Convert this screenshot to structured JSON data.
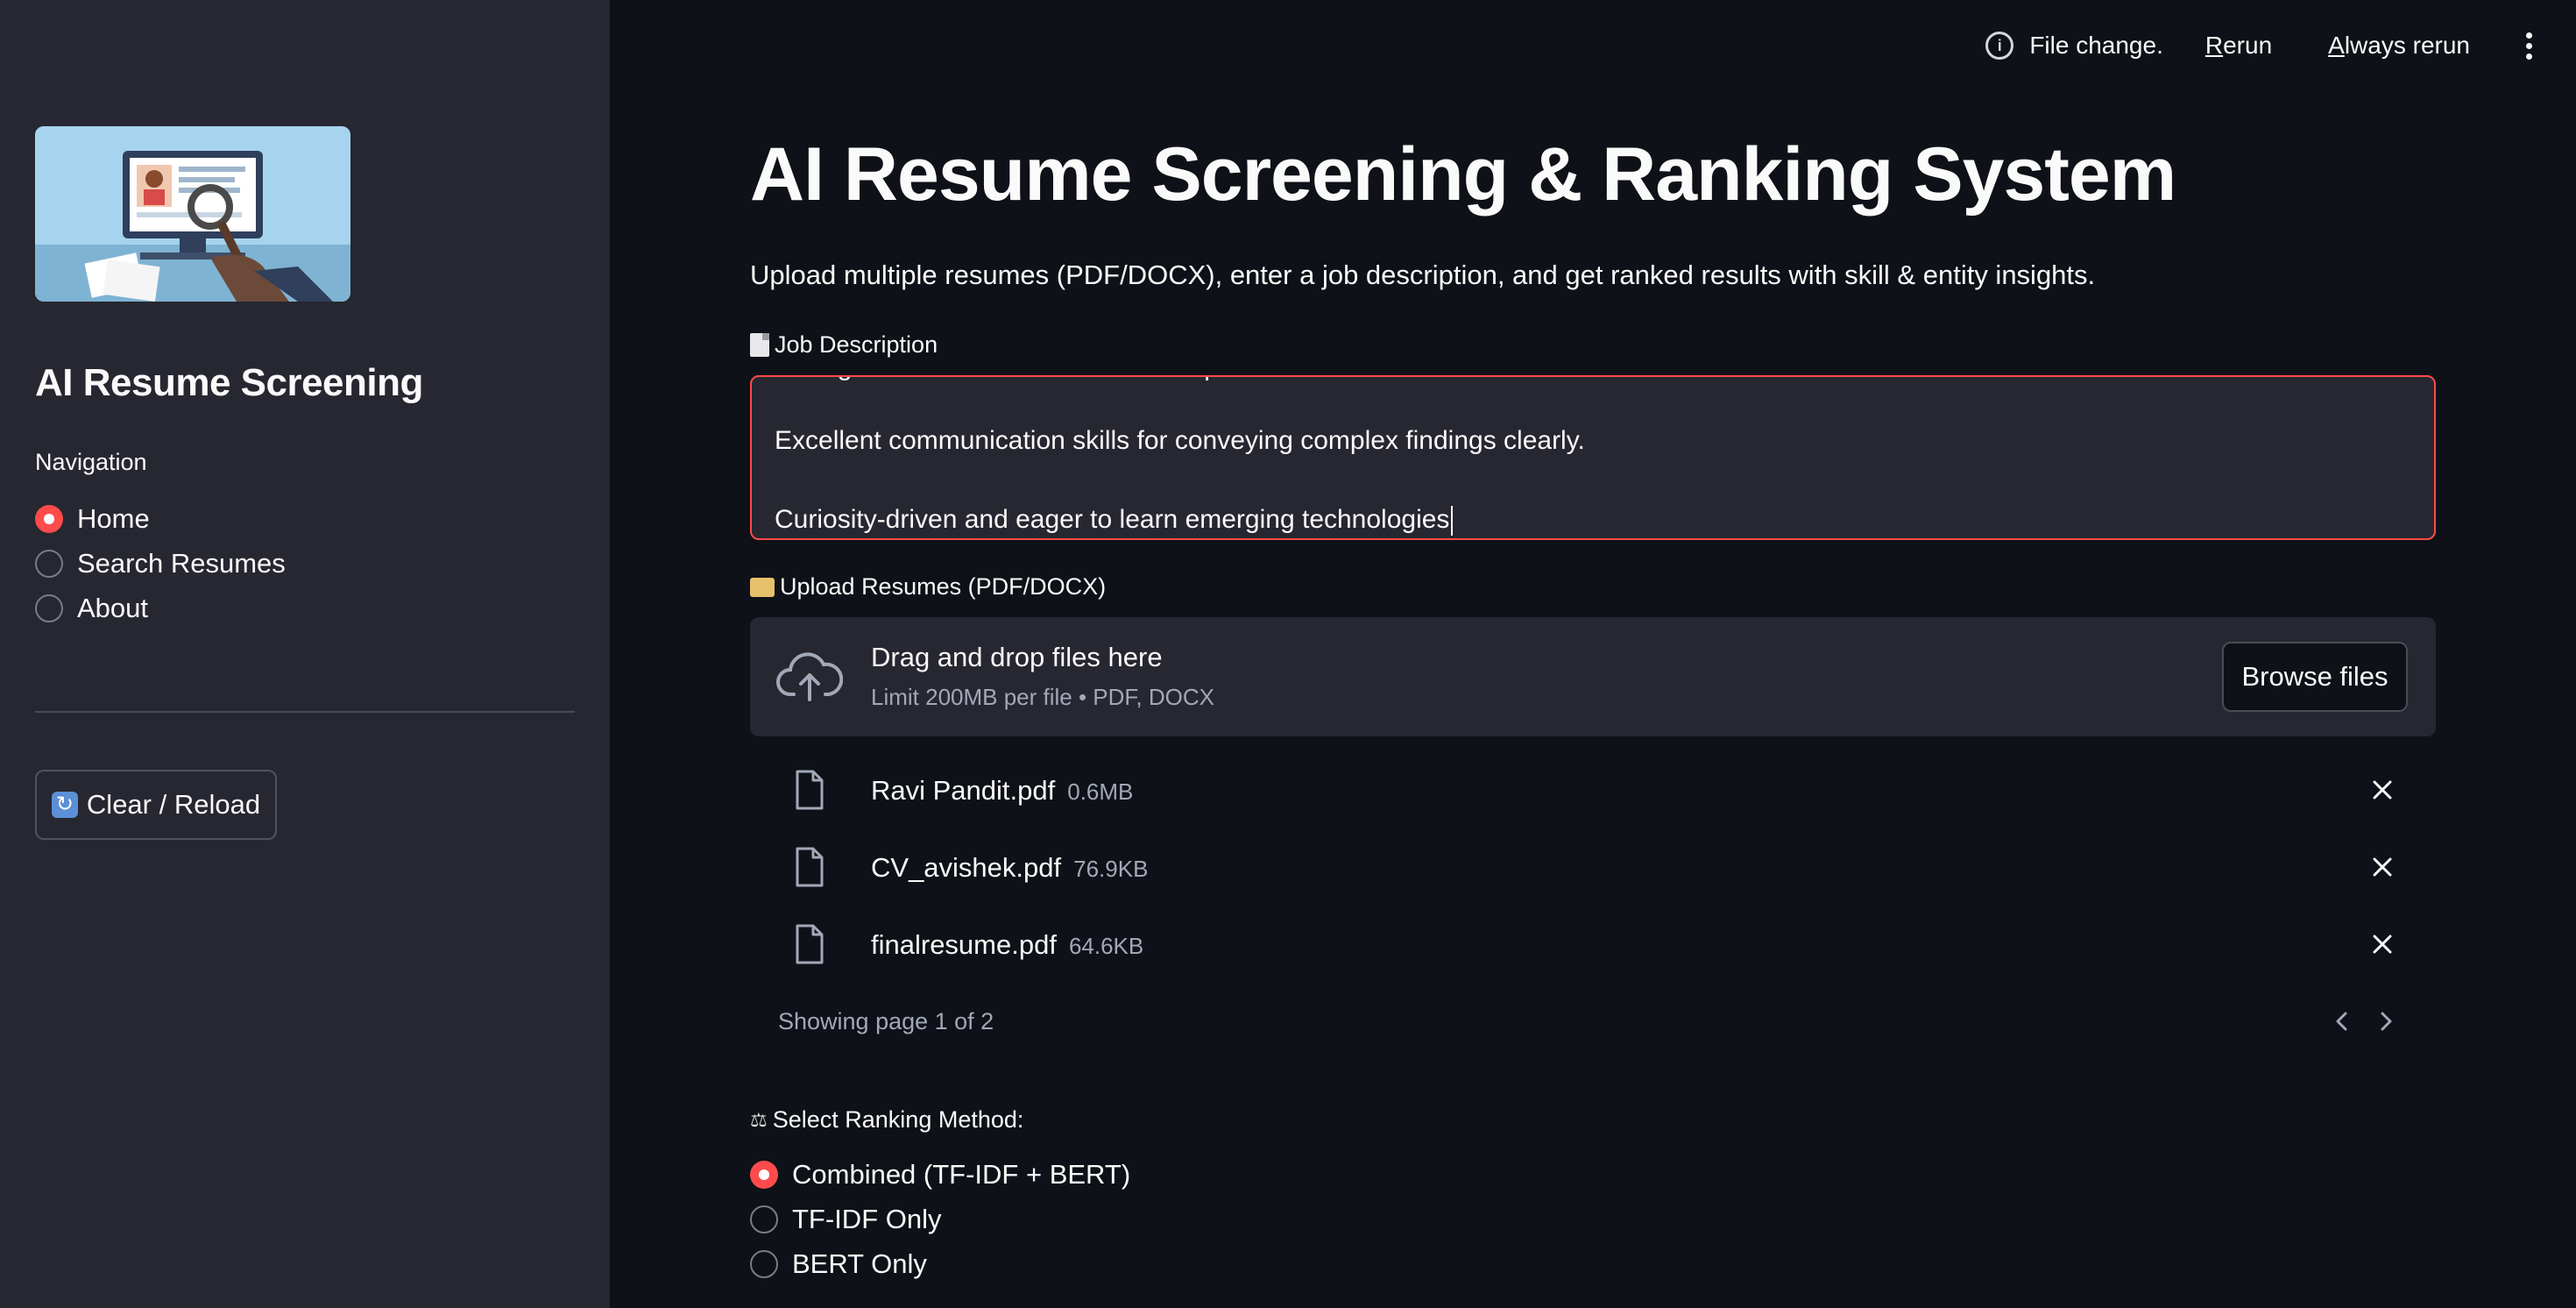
{
  "sidebar": {
    "app_title": "AI Resume Screening",
    "nav_label": "Navigation",
    "nav_items": [
      {
        "label": "Home",
        "checked": true
      },
      {
        "label": "Search Resumes",
        "checked": false
      },
      {
        "label": "About",
        "checked": false
      }
    ],
    "clear_button": "Clear / Reload"
  },
  "header": {
    "status": "File change.",
    "rerun_underlined": "R",
    "rerun_rest": "erun",
    "always_underlined": "A",
    "always_rest": "lways rerun"
  },
  "main": {
    "title": "AI Resume Screening & Ranking System",
    "subtitle": "Upload multiple resumes (PDF/DOCX), enter a job description, and get ranked results with skill & entity insights.",
    "job_label": "Job Description",
    "job_lines": [
      "Strong mathematical and statistical aptitude",
      "Excellent communication skills for conveying complex findings clearly.",
      "Curiosity-driven and eager to learn emerging technologies"
    ],
    "upload_label": "Upload Resumes (PDF/DOCX)",
    "dropzone_title": "Drag and drop files here",
    "dropzone_sub": "Limit 200MB per file • PDF, DOCX",
    "browse_button": "Browse files",
    "files": [
      {
        "name": "Ravi Pandit.pdf",
        "size": "0.6MB"
      },
      {
        "name": "CV_avishek.pdf",
        "size": "76.9KB"
      },
      {
        "name": "finalresume.pdf",
        "size": "64.6KB"
      }
    ],
    "pager_text": "Showing page 1 of 2",
    "ranking_label": "Select Ranking Method:",
    "ranking_options": [
      {
        "label": "Combined (TF-IDF + BERT)",
        "checked": true
      },
      {
        "label": "TF-IDF Only",
        "checked": false
      },
      {
        "label": "BERT Only",
        "checked": false
      }
    ]
  },
  "colors": {
    "accent": "#ff4b4b",
    "background": "#0e1117",
    "sidebar": "#262730"
  }
}
